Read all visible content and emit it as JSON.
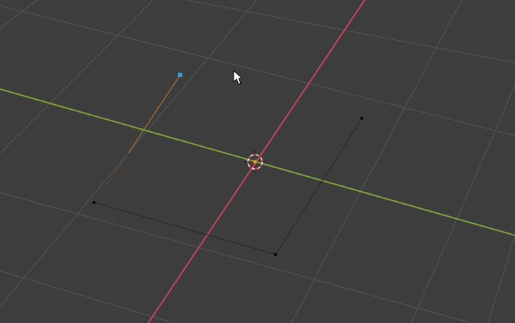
{
  "viewport": {
    "background": "#3d3d3d",
    "grid_color": "#575757",
    "x_axis_color": "#c2485a",
    "y_axis_color": "#7ea33a",
    "edge_color": "#262626",
    "vertex_color": "#0d0d0d",
    "selected_vertex_color": "#3d9dd9",
    "selected_edge_color": "#c97a2a",
    "origin_color": "#ff9a1f",
    "cursor_ring_colors": [
      "#e0e0e0",
      "#d63c3c"
    ],
    "icons": {
      "cursor_3d": "3d-cursor-icon",
      "mouse_pointer": "mouse-pointer-icon"
    }
  }
}
